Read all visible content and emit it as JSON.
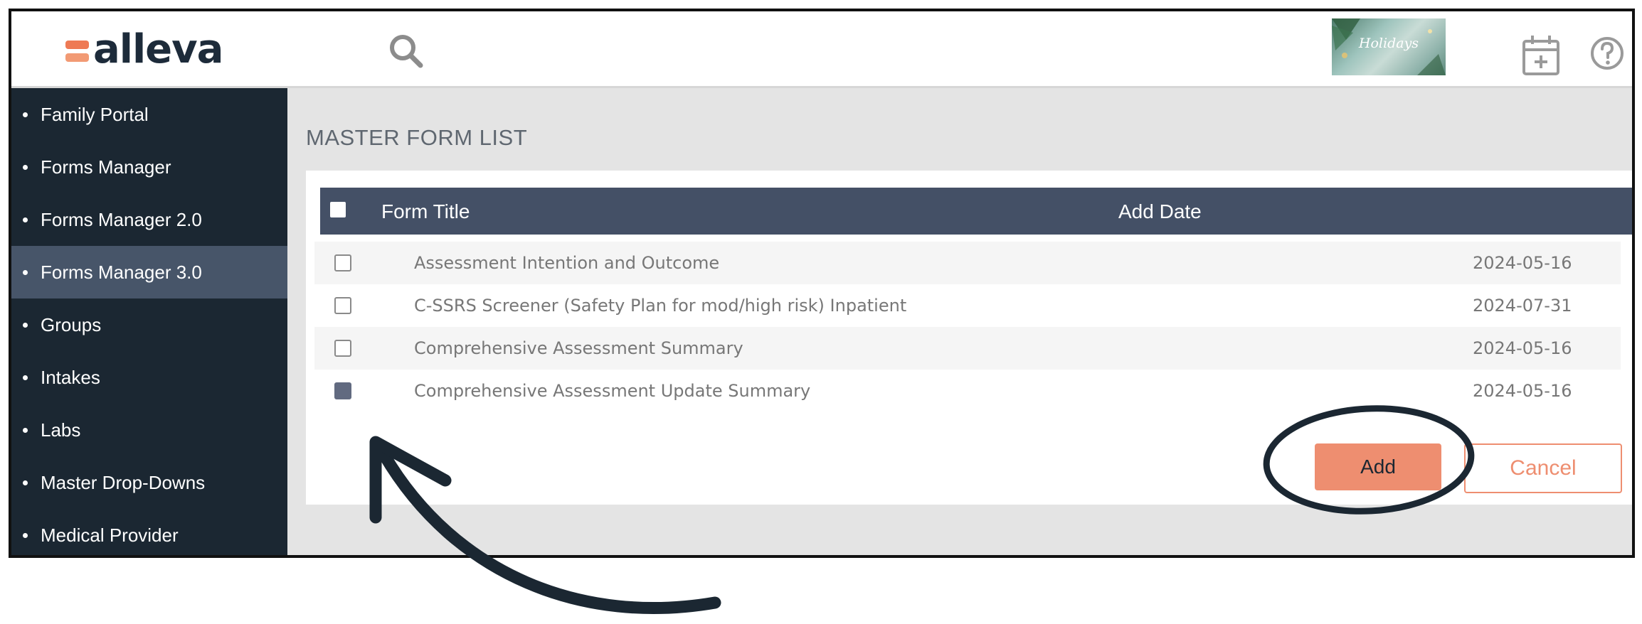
{
  "app": {
    "logo_text": "alleva",
    "logo_colors": [
      "#ee7a55",
      "#f29a74"
    ],
    "holiday_banner_text": "Holidays"
  },
  "icons": {
    "search": "search-icon",
    "calendar": "calendar-add-icon",
    "help": "help-icon"
  },
  "sidebar": {
    "items": [
      {
        "label": "Family Portal",
        "active": false
      },
      {
        "label": "Forms Manager",
        "active": false
      },
      {
        "label": "Forms Manager 2.0",
        "active": false
      },
      {
        "label": "Forms Manager 3.0",
        "active": true
      },
      {
        "label": "Groups",
        "active": false
      },
      {
        "label": "Intakes",
        "active": false
      },
      {
        "label": "Labs",
        "active": false
      },
      {
        "label": "Master Drop-Downs",
        "active": false
      },
      {
        "label": "Medical Provider",
        "active": false
      }
    ]
  },
  "main": {
    "title": "MASTER FORM LIST",
    "table": {
      "columns": [
        "Form Title",
        "Add Date"
      ],
      "rows": [
        {
          "title": "Assessment Intention and Outcome",
          "date": "2024-05-16",
          "checked": false
        },
        {
          "title": "C-SSRS Screener (Safety Plan for mod/high risk) Inpatient",
          "date": "2024-07-31",
          "checked": false
        },
        {
          "title": "Comprehensive Assessment Summary",
          "date": "2024-05-16",
          "checked": false
        },
        {
          "title": "Comprehensive Assessment Update Summary",
          "date": "2024-05-16",
          "checked": true
        }
      ]
    },
    "buttons": {
      "add": "Add",
      "cancel": "Cancel"
    }
  },
  "colors": {
    "sidebar_bg": "#1b2732",
    "sidebar_active": "#475569",
    "table_header": "#445066",
    "accent": "#ee8e70",
    "annotation": "#1b2732"
  }
}
